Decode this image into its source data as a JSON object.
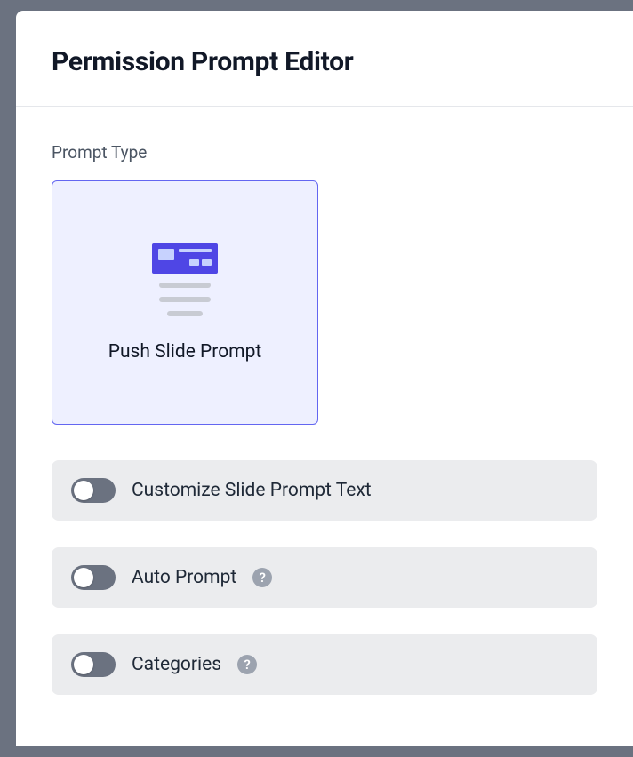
{
  "header": {
    "title": "Permission Prompt Editor"
  },
  "promptType": {
    "sectionLabel": "Prompt Type",
    "selectedCard": {
      "label": "Push Slide Prompt"
    }
  },
  "toggles": {
    "customizeText": {
      "label": "Customize Slide Prompt Text",
      "enabled": false
    },
    "autoPrompt": {
      "label": "Auto Prompt",
      "enabled": false,
      "helpIcon": "?"
    },
    "categories": {
      "label": "Categories",
      "enabled": false,
      "helpIcon": "?"
    }
  }
}
